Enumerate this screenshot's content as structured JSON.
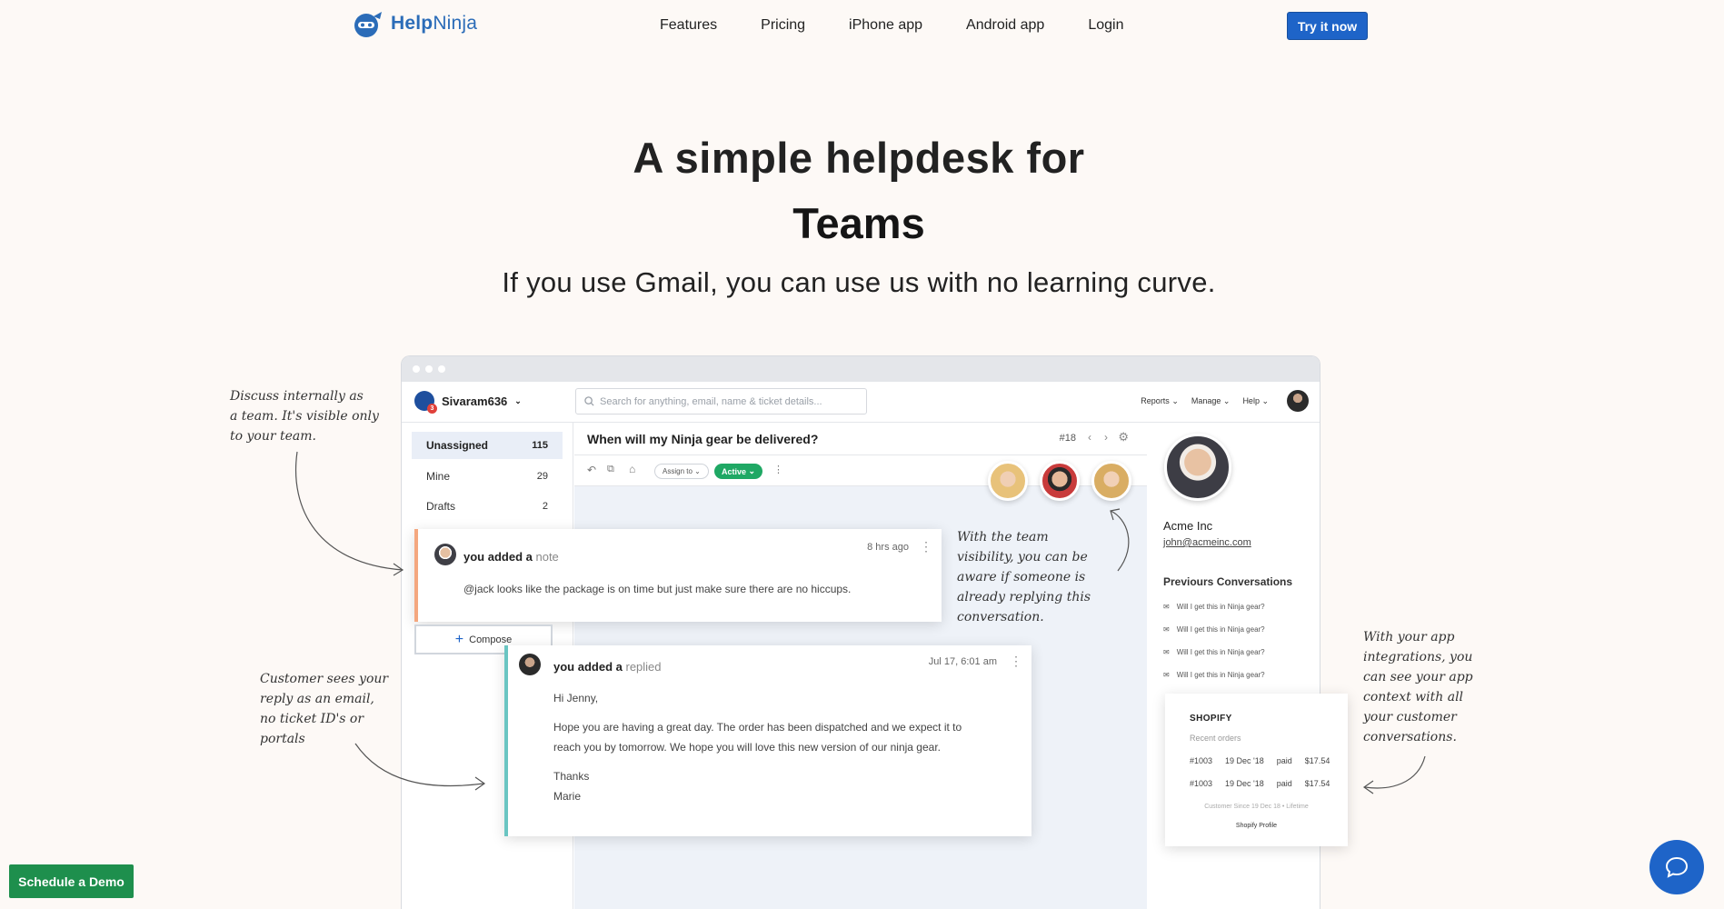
{
  "brand": {
    "name_bold": "Help",
    "name_light": "Ninja"
  },
  "nav": {
    "features": "Features",
    "pricing": "Pricing",
    "iphone": "iPhone app",
    "android": "Android app",
    "login": "Login",
    "cta": "Try it now"
  },
  "hero": {
    "line1": "A simple helpdesk for",
    "line2": "Teams",
    "subtitle": "If you use Gmail, you can use us with no learning curve."
  },
  "app": {
    "workspace": "Sivaram636",
    "workspace_badge": "3",
    "search_placeholder": "Search for anything, email, name & ticket details...",
    "menu": {
      "reports": "Reports",
      "manage": "Manage",
      "help": "Help"
    },
    "folders": [
      {
        "label": "Unassigned",
        "count": "115"
      },
      {
        "label": "Mine",
        "count": "29"
      },
      {
        "label": "Drafts",
        "count": "2"
      }
    ],
    "ticket": {
      "subject": "When will my Ninja gear be delivered?",
      "number": "#18",
      "assign": "Assign to",
      "status": "Active"
    },
    "customer": {
      "name": "Acme Inc",
      "email": "john@acmeinc.com"
    },
    "previous": {
      "title": "Previours Conversations",
      "items": [
        "Will I get this in Ninja gear?",
        "Will I get this in Ninja gear?",
        "Will I get this in Ninja gear?",
        "Will I get this in Ninja gear?"
      ]
    }
  },
  "note": {
    "who": "you added a",
    "kind": "note",
    "time": "8 hrs ago",
    "text": "@jack looks like the package is on time but just make sure there are no hiccups."
  },
  "compose": "Compose",
  "reply": {
    "who": "you added a",
    "kind": "replied",
    "time": "Jul 17, 6:01 am",
    "greeting": "Hi Jenny,",
    "body1": "Hope you are having a great day. The order has been dispatched and we expect it to",
    "body2": "reach you by tomorrow. We hope you will love this new version of our ninja gear.",
    "thanks": "Thanks",
    "signature": "Marie"
  },
  "shopify": {
    "title": "SHOPIFY",
    "subtitle": "Recent orders",
    "orders": [
      {
        "id": "#1003",
        "date": "19 Dec '18",
        "status": "paid",
        "amount": "$17.54"
      },
      {
        "id": "#1003",
        "date": "19 Dec '18",
        "status": "paid",
        "amount": "$17.54"
      }
    ],
    "since": "Customer Since 19 Dec 18 • Lifetime",
    "profile": "Shopify Profile"
  },
  "annotations": {
    "internal": [
      "Discuss internally as",
      "a team. It's visible only",
      "to your team."
    ],
    "email": [
      "Customer sees your",
      "reply as an email,",
      "no ticket ID's or",
      "portals"
    ],
    "visibility": [
      "With the team",
      "visibility, you can be",
      "aware if someone is",
      "already replying this",
      "conversation."
    ],
    "integrations": [
      "With your app",
      "integrations, you",
      "can see your app",
      "context with all",
      "your customer",
      "conversations."
    ]
  },
  "demo": "Schedule a Demo"
}
